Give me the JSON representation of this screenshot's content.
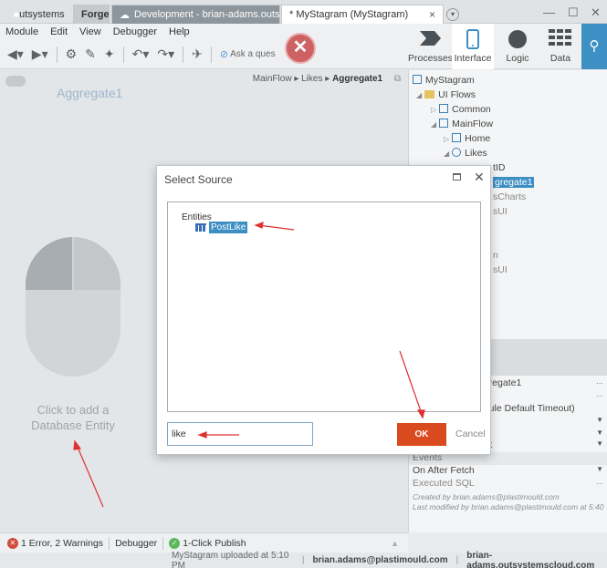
{
  "tabs": {
    "brand": "outsystems",
    "forge": "Forge",
    "development": "Development - brian-adams.outs...",
    "mystagram": "* MyStagram (MyStagram)",
    "close_glyph": "×"
  },
  "window": {
    "minimize": "—",
    "maximize": "☐",
    "close": "✕"
  },
  "menu": [
    "Module",
    "Edit",
    "View",
    "Debugger",
    "Help"
  ],
  "toolbar": {
    "ask_question": "Ask a ques"
  },
  "rightnav": {
    "items": [
      "Processes",
      "Interface",
      "Logic",
      "Data"
    ],
    "active": "Interface"
  },
  "canvas": {
    "breadcrumb_flow": "MainFlow",
    "breadcrumb_screen": "Likes",
    "breadcrumb_current": "Aggregate1",
    "title": "Aggregate1",
    "click_to_add": "Click to add a Database Entity"
  },
  "tree": {
    "root": "MyStagram",
    "ui_flows": "UI Flows",
    "common": "Common",
    "mainflow": "MainFlow",
    "home": "Home",
    "likes": "Likes",
    "partial_1": "tID",
    "partial_2": "gregate1",
    "partial_3": "sCharts",
    "partial_4": "sUI",
    "partial_5": "n",
    "partial_6": "sUI"
  },
  "properties": {
    "name_value": "ggregate1",
    "timeout_value": "odule Default Timeout)",
    "start_value": "tart",
    "events_label": "Events",
    "on_after_fetch": "On After Fetch",
    "executed_sql": "Executed SQL",
    "created_by": "Created by brian.adams@plastimould.com",
    "modified_by": "Last modified by brian.adams@plastimould.com at 5:40"
  },
  "dialog": {
    "title": "Select Source",
    "entities_label": "Entities",
    "entity": "PostLike",
    "search_value": "like",
    "ok": "OK",
    "cancel": "Cancel"
  },
  "errors": {
    "summary": "1 Error, 2 Warnings",
    "debugger": "Debugger",
    "publish": "1-Click Publish"
  },
  "status": {
    "upload": "MyStagram uploaded at 5:10 PM",
    "user": "brian.adams@plastimould.com",
    "server": "brian-adams.outsystemscloud.com"
  },
  "colors": {
    "ok_button": "#d94a1e",
    "selection": "#3d8fc4",
    "annotation": "#e03030"
  }
}
